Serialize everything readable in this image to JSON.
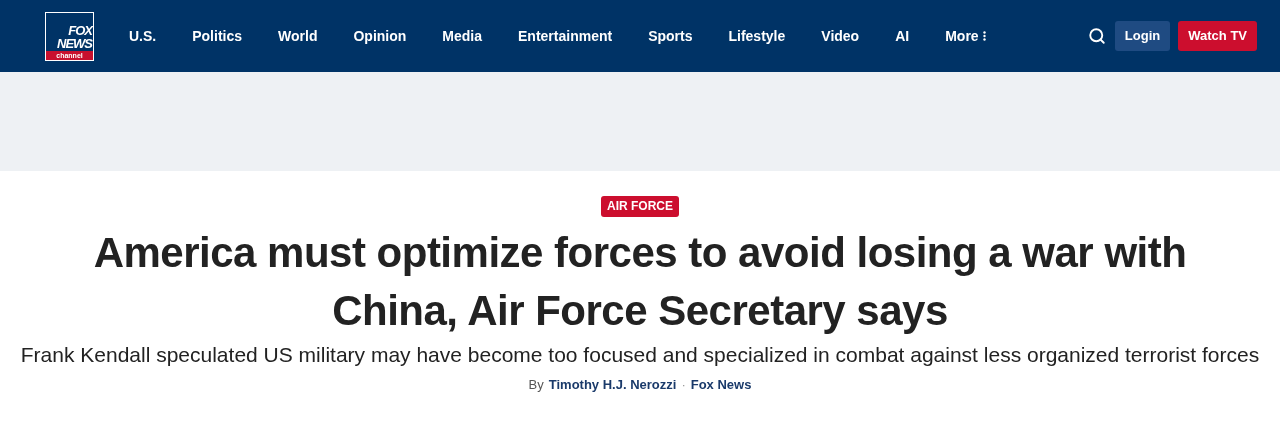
{
  "logo": {
    "lines": [
      "FOX",
      "NEWS"
    ],
    "tagline": "channel"
  },
  "nav": [
    {
      "label": "U.S."
    },
    {
      "label": "Politics"
    },
    {
      "label": "World"
    },
    {
      "label": "Opinion"
    },
    {
      "label": "Media"
    },
    {
      "label": "Entertainment"
    },
    {
      "label": "Sports"
    },
    {
      "label": "Lifestyle"
    },
    {
      "label": "Video"
    },
    {
      "label": "AI"
    },
    {
      "label": "More",
      "kind": "menu"
    }
  ],
  "buttons": {
    "login": "Login",
    "watch": "Watch TV"
  },
  "article": {
    "category": "AIR FORCE",
    "headline": "America must optimize forces to avoid losing a war with China, Air Force Secretary says",
    "subheadline": "Frank Kendall speculated US military may have become too focused and specialized in combat against less organized terrorist forces",
    "byline": {
      "prefix": "By",
      "author": "Timothy H.J. Nerozzi",
      "separator": "·",
      "source": "Fox News"
    }
  }
}
